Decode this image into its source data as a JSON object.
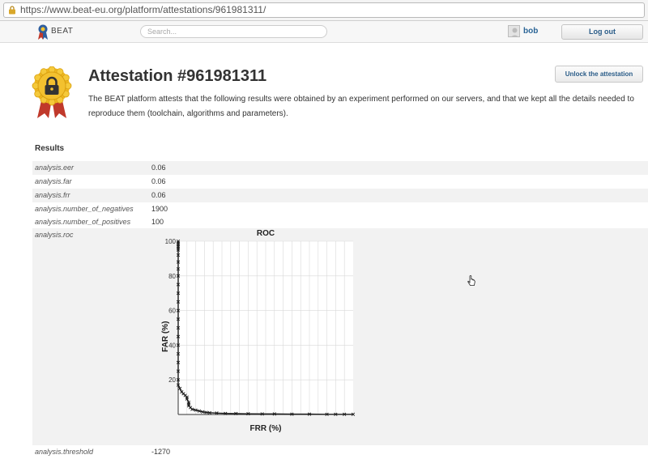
{
  "browser": {
    "url": "https://www.beat-eu.org/platform/attestations/961981311/"
  },
  "navbar": {
    "logo_text": "BEAT",
    "search_placeholder": "Search...",
    "username": "bob",
    "logout_label": "Log out"
  },
  "header": {
    "title": "Attestation #961981311",
    "description": "The BEAT platform attests that the following results were obtained by an experiment performed on our servers, and that we kept all the details needed to reproduce them (toolchain, algorithms and parameters).",
    "unlock_label": "Unlock the attestation"
  },
  "results": {
    "heading": "Results",
    "rows": [
      {
        "key": "analysis.eer",
        "value": "0.06"
      },
      {
        "key": "analysis.far",
        "value": "0.06"
      },
      {
        "key": "analysis.frr",
        "value": "0.06"
      },
      {
        "key": "analysis.number_of_negatives",
        "value": "1900"
      },
      {
        "key": "analysis.number_of_positives",
        "value": "100"
      },
      {
        "key": "analysis.roc",
        "value": ""
      }
    ],
    "threshold": {
      "key": "analysis.threshold",
      "value": "-1270"
    }
  },
  "chart_data": {
    "type": "line",
    "title": "ROC",
    "xlabel": "FRR (%)",
    "ylabel": "FAR (%)",
    "xlim": [
      0,
      100
    ],
    "ylim": [
      0,
      100
    ],
    "y_ticks": [
      20,
      40,
      60,
      80,
      100
    ],
    "grid": true,
    "series": [
      {
        "color": "#1a1a1a",
        "marker": "x",
        "x": [
          0,
          0,
          0,
          0,
          0,
          0,
          0,
          0,
          0,
          0,
          0,
          0,
          0,
          0,
          0,
          0,
          0,
          0,
          0,
          0,
          0,
          0,
          0,
          1,
          2,
          3,
          4,
          5,
          5,
          6,
          6,
          6,
          7,
          8,
          10,
          12,
          14,
          16,
          18,
          22,
          27,
          33,
          40,
          48,
          55,
          65,
          75,
          85,
          90,
          95,
          100
        ],
        "y": [
          100,
          99,
          98,
          97,
          96,
          95,
          92,
          88,
          84,
          80,
          75,
          70,
          65,
          60,
          55,
          50,
          45,
          40,
          35,
          30,
          25,
          20,
          17,
          15,
          13,
          12,
          11,
          10,
          9,
          7,
          6,
          5,
          4,
          3,
          2.5,
          2,
          1.5,
          1.2,
          1,
          0.8,
          0.6,
          0.5,
          0.4,
          0.3,
          0.3,
          0.2,
          0.2,
          0.1,
          0.1,
          0.1,
          0.1
        ]
      }
    ]
  }
}
